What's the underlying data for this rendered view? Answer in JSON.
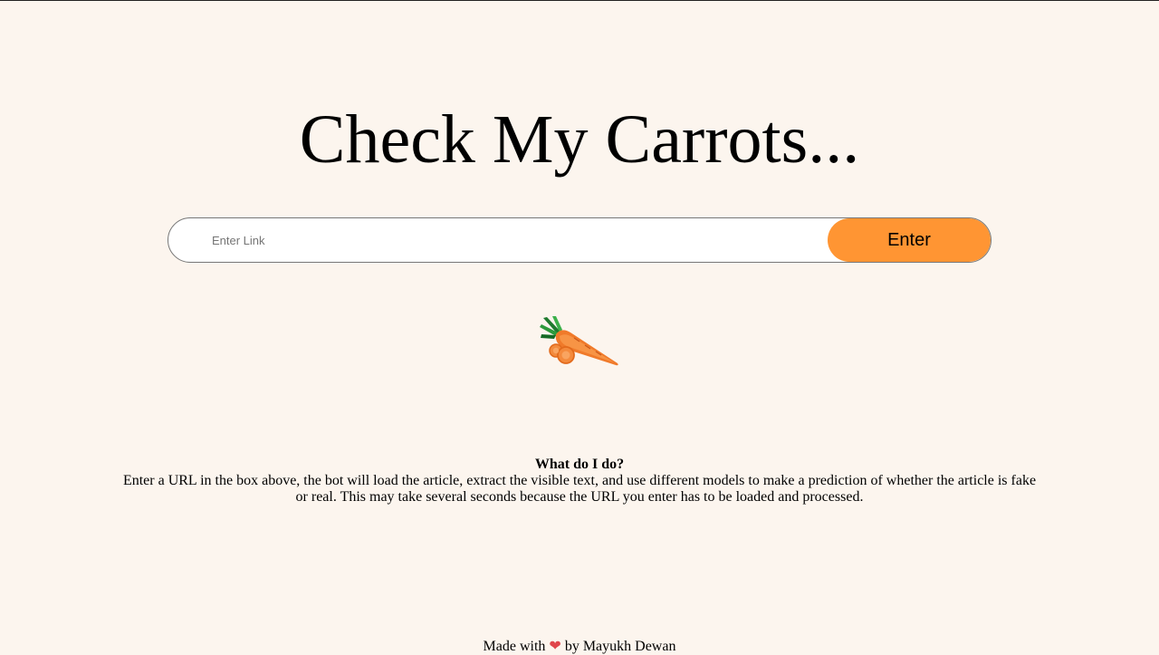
{
  "header": {
    "title": "Check My Carrots..."
  },
  "search": {
    "placeholder": "Enter Link",
    "value": "",
    "button_label": "Enter"
  },
  "mascot": {
    "icon": "carrot-icon"
  },
  "about": {
    "heading": "What do I do?",
    "text": "Enter a URL in the box above, the bot will load the article, extract the visible text, and use different models to make a prediction of whether the article is fake or real. This may take several seconds because the URL you enter has to be loaded and processed."
  },
  "footer": {
    "prefix": "Made with",
    "heart": "❤",
    "suffix": "by Mayukh Dewan"
  },
  "colors": {
    "background": "#fcf5ee",
    "accent": "#ff9533",
    "heart": "#e0464b"
  }
}
